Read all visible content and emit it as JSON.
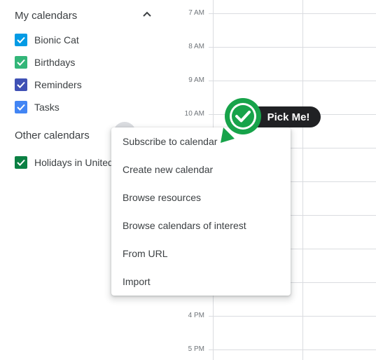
{
  "sidebar": {
    "my_calendars": {
      "title": "My calendars",
      "items": [
        {
          "label": "Bionic Cat",
          "color": "#039be5"
        },
        {
          "label": "Birthdays",
          "color": "#33b679"
        },
        {
          "label": "Reminders",
          "color": "#3f51b5"
        },
        {
          "label": "Tasks",
          "color": "#4285f4"
        }
      ]
    },
    "other_calendars": {
      "title": "Other calendars",
      "items": [
        {
          "label": "Holidays in United States",
          "color": "#0b8043"
        }
      ]
    }
  },
  "time_grid": {
    "labels": [
      "7 AM",
      "8 AM",
      "9 AM",
      "10 AM",
      "4 PM",
      "5 PM"
    ]
  },
  "menu": {
    "items": [
      "Subscribe to calendar",
      "Create new calendar",
      "Browse resources",
      "Browse calendars of interest",
      "From URL",
      "Import"
    ]
  },
  "callout": {
    "text": "Pick Me!",
    "color": "#17a34a"
  }
}
